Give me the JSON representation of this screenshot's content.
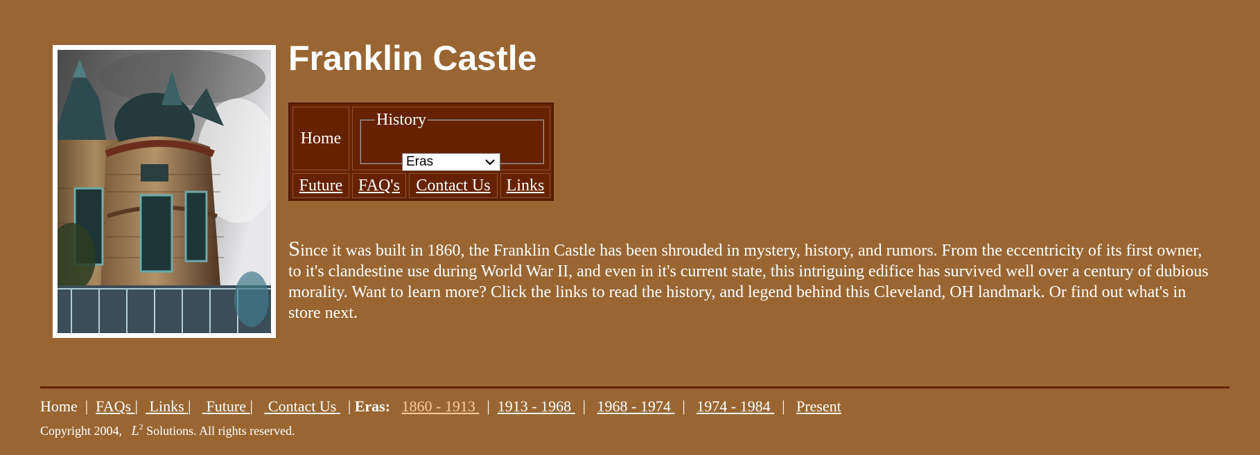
{
  "page": {
    "title": "Franklin Castle",
    "photo_alt": "Franklin Castle turret photo"
  },
  "nav": {
    "home": "Home",
    "history_legend": "History",
    "eras_select_value": "Eras",
    "future": "Future",
    "faqs": "FAQ's",
    "contact": "Contact Us",
    "links": "Links"
  },
  "intro": {
    "dropcap": "S",
    "text": "ince it was built in 1860, the Franklin Castle has been shrouded in mystery, history, and rumors. From the eccentricity of its first owner, to it's clandestine use during World War II, and even in it's current state, this intriguing edifice has survived well over a century of dubious morality. Want to learn more? Click the links to read the history, and legend behind this Cleveland, OH landmark. Or find out what's in store next."
  },
  "footer": {
    "home": "Home",
    "faqs": "FAQs ",
    "links": " Links ",
    "future": " Future ",
    "contact": " Contact Us ",
    "eras_label": "Eras:",
    "eras": [
      "1860 - 1913 ",
      "1913 - 1968 ",
      "1968 - 1974 ",
      "1974 - 1984 ",
      "Present"
    ],
    "copyright_prefix": "Copyright 2004,   ",
    "copyright_l": "L",
    "copyright_sup": "2",
    "copyright_suffix": " Solutions. All rights reserved."
  },
  "colors": {
    "background": "#996633",
    "nav_bg": "#662200",
    "visited_link": "#ffcc99",
    "text": "#ffffff"
  },
  "icons": {
    "select_arrow": "chevron-down-icon"
  }
}
